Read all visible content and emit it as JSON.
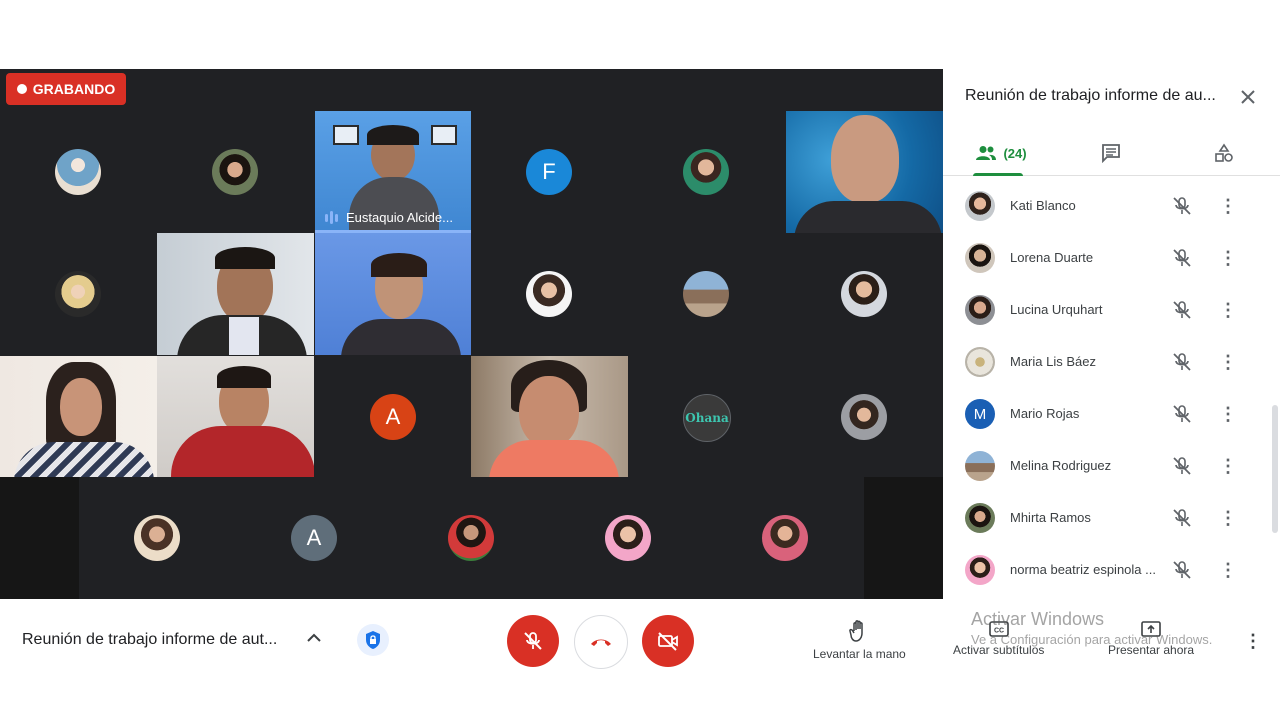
{
  "recording": {
    "label": "GRABANDO",
    "color": "#d93025"
  },
  "tiles": {
    "speaker_name": "Eustaquio Alcide...",
    "letter_f": "F",
    "letter_a1": "A",
    "letter_a2": "A",
    "ohana_label": "Ohana"
  },
  "panel": {
    "title": "Reunión de trabajo informe de au...",
    "people_count": "(24)",
    "people": [
      {
        "name": "Kati Blanco",
        "initial": ""
      },
      {
        "name": "Lorena Duarte",
        "initial": ""
      },
      {
        "name": "Lucina Urquhart",
        "initial": ""
      },
      {
        "name": "Maria Lis Báez",
        "initial": ""
      },
      {
        "name": "Mario Rojas",
        "initial": "M"
      },
      {
        "name": "Melina Rodriguez",
        "initial": ""
      },
      {
        "name": "Mhirta Ramos",
        "initial": ""
      },
      {
        "name": "norma beatriz espinola ...",
        "initial": ""
      }
    ]
  },
  "bottom": {
    "meeting_title": "Reunión de trabajo informe de aut...",
    "raise_hand": "Levantar la mano",
    "captions": "Activar subtítulos",
    "present": "Presentar ahora"
  },
  "watermark": {
    "line1": "Activar Windows",
    "line2": "Ve a Configuración para activar Windows."
  },
  "colors": {
    "accent_green": "#1e8e3e",
    "danger_red": "#d93025",
    "tile_bg": "#202124"
  }
}
